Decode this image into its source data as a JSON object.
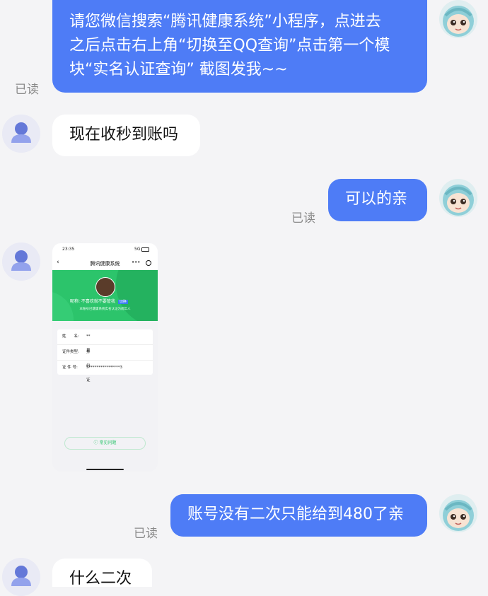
{
  "messages": {
    "m1": {
      "text": "请您微信搜索“腾讯健康系统”小程序，点进去之后点击右上角“切换至QQ查询”点击第一个模块“实名认证查询” 截图发我~~",
      "line1": "请您微信搜索“腾讯健康系统”小程序，点进去",
      "line2": "之后点击右上角“切换至QQ查询”点击第一个模",
      "line3": "块“实名认证查询” 截图发我~~",
      "status": "已读"
    },
    "m2": {
      "text": "现在收秒到账吗"
    },
    "m3": {
      "text": "可以的亲",
      "status": "已读"
    },
    "m4": {
      "screenshot": {
        "time": "23:35",
        "signal": "5G",
        "title": "腾讯健康系统",
        "nickname": "昵称: 不喜欢就不要管我",
        "tag": "切换",
        "subtitle": "本账号已健康系统实名认证为成年人",
        "fields": [
          {
            "label": "姓　　名:",
            "value": "**泉"
          },
          {
            "label": "证件类型:",
            "value": "身份证"
          },
          {
            "label": "证  件  号:",
            "value": "5****************3"
          }
        ],
        "faq": "常见问题"
      }
    },
    "m5": {
      "text": "账号没有二次只能给到480了亲",
      "status": "已读"
    },
    "m6": {
      "text": "什么二次"
    }
  }
}
